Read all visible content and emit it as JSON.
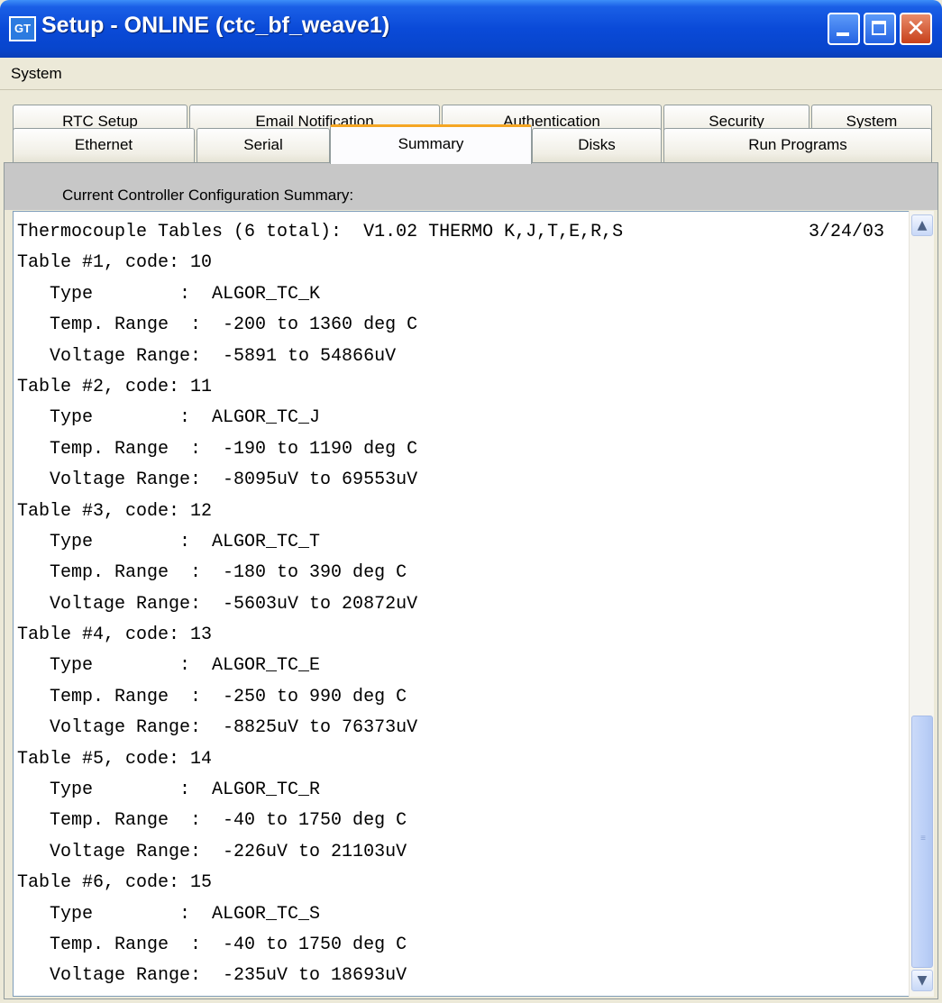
{
  "window": {
    "title": "Setup - ONLINE (ctc_bf_weave1)",
    "controls": {
      "minimize": "minimize-icon",
      "maximize": "maximize-icon",
      "close": "close-icon"
    }
  },
  "menu": {
    "items": [
      "System"
    ]
  },
  "tabs": {
    "back_row": [
      "RTC Setup",
      "Email Notification",
      "Authentication",
      "Security",
      "System"
    ],
    "front_row": [
      "Ethernet",
      "Serial",
      "Summary",
      "Disks",
      "Run Programs"
    ],
    "selected": "Summary",
    "accent_color": "#f5a623"
  },
  "panel": {
    "label": "Current Controller Configuration Summary:"
  },
  "summary": {
    "header": "Thermocouple Tables (6 total):  V1.02 THERMO K,J,T,E,R,S",
    "date": "3/24/03",
    "lines": [
      "Table #1, code: 10",
      "   Type        :  ALGOR_TC_K",
      "   Temp. Range  :  -200 to 1360 deg C",
      "   Voltage Range:  -5891 to 54866uV",
      "Table #2, code: 11",
      "   Type        :  ALGOR_TC_J",
      "   Temp. Range  :  -190 to 1190 deg C",
      "   Voltage Range:  -8095uV to 69553uV",
      "Table #3, code: 12",
      "   Type        :  ALGOR_TC_T",
      "   Temp. Range  :  -180 to 390 deg C",
      "   Voltage Range:  -5603uV to 20872uV",
      "Table #4, code: 13",
      "   Type        :  ALGOR_TC_E",
      "   Temp. Range  :  -250 to 990 deg C",
      "   Voltage Range:  -8825uV to 76373uV",
      "Table #5, code: 14",
      "   Type        :  ALGOR_TC_R",
      "   Temp. Range  :  -40 to 1750 deg C",
      "   Voltage Range:  -226uV to 21103uV",
      "Table #6, code: 15",
      "   Type        :  ALGOR_TC_S",
      "   Temp. Range  :  -40 to 1750 deg C",
      "   Voltage Range:  -235uV to 18693uV"
    ]
  },
  "scrollbar": {
    "up_icon": "chevron-up-icon",
    "down_icon": "chevron-down-icon"
  }
}
